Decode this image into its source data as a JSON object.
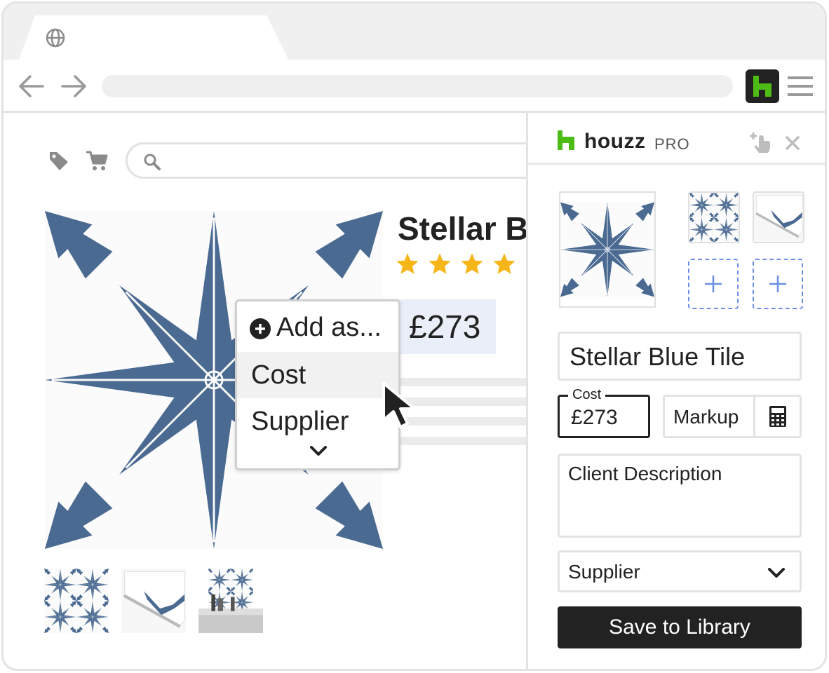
{
  "browser": {
    "tab_icon": "globe-icon",
    "back_icon": "arrow-left-icon",
    "forward_icon": "arrow-right-icon",
    "extension_icon": "houzz-logo-icon",
    "menu_icon": "hamburger-menu-icon"
  },
  "product_page": {
    "title": "Stellar B",
    "rating_stars": 4,
    "price": "£273",
    "icons": [
      "tag-icon",
      "cart-icon",
      "search-icon"
    ]
  },
  "context_menu": {
    "title": "Add as...",
    "items": [
      "Cost",
      "Supplier"
    ]
  },
  "panel": {
    "brand": "houzz",
    "brand_suffix": "PRO",
    "product_name": "Stellar Blue Tile",
    "cost_label": "Cost",
    "cost_value": "£273",
    "markup_label": "Markup",
    "client_description_placeholder": "Client Description",
    "supplier_select": "Supplier",
    "save_button": "Save to Library"
  },
  "colors": {
    "tile_blue": "#4a6a92",
    "houzz_green": "#4dbc15",
    "star_yellow": "#f6b518",
    "dashed_blue": "#6b8fe6",
    "price_bg": "#e9eef9"
  }
}
